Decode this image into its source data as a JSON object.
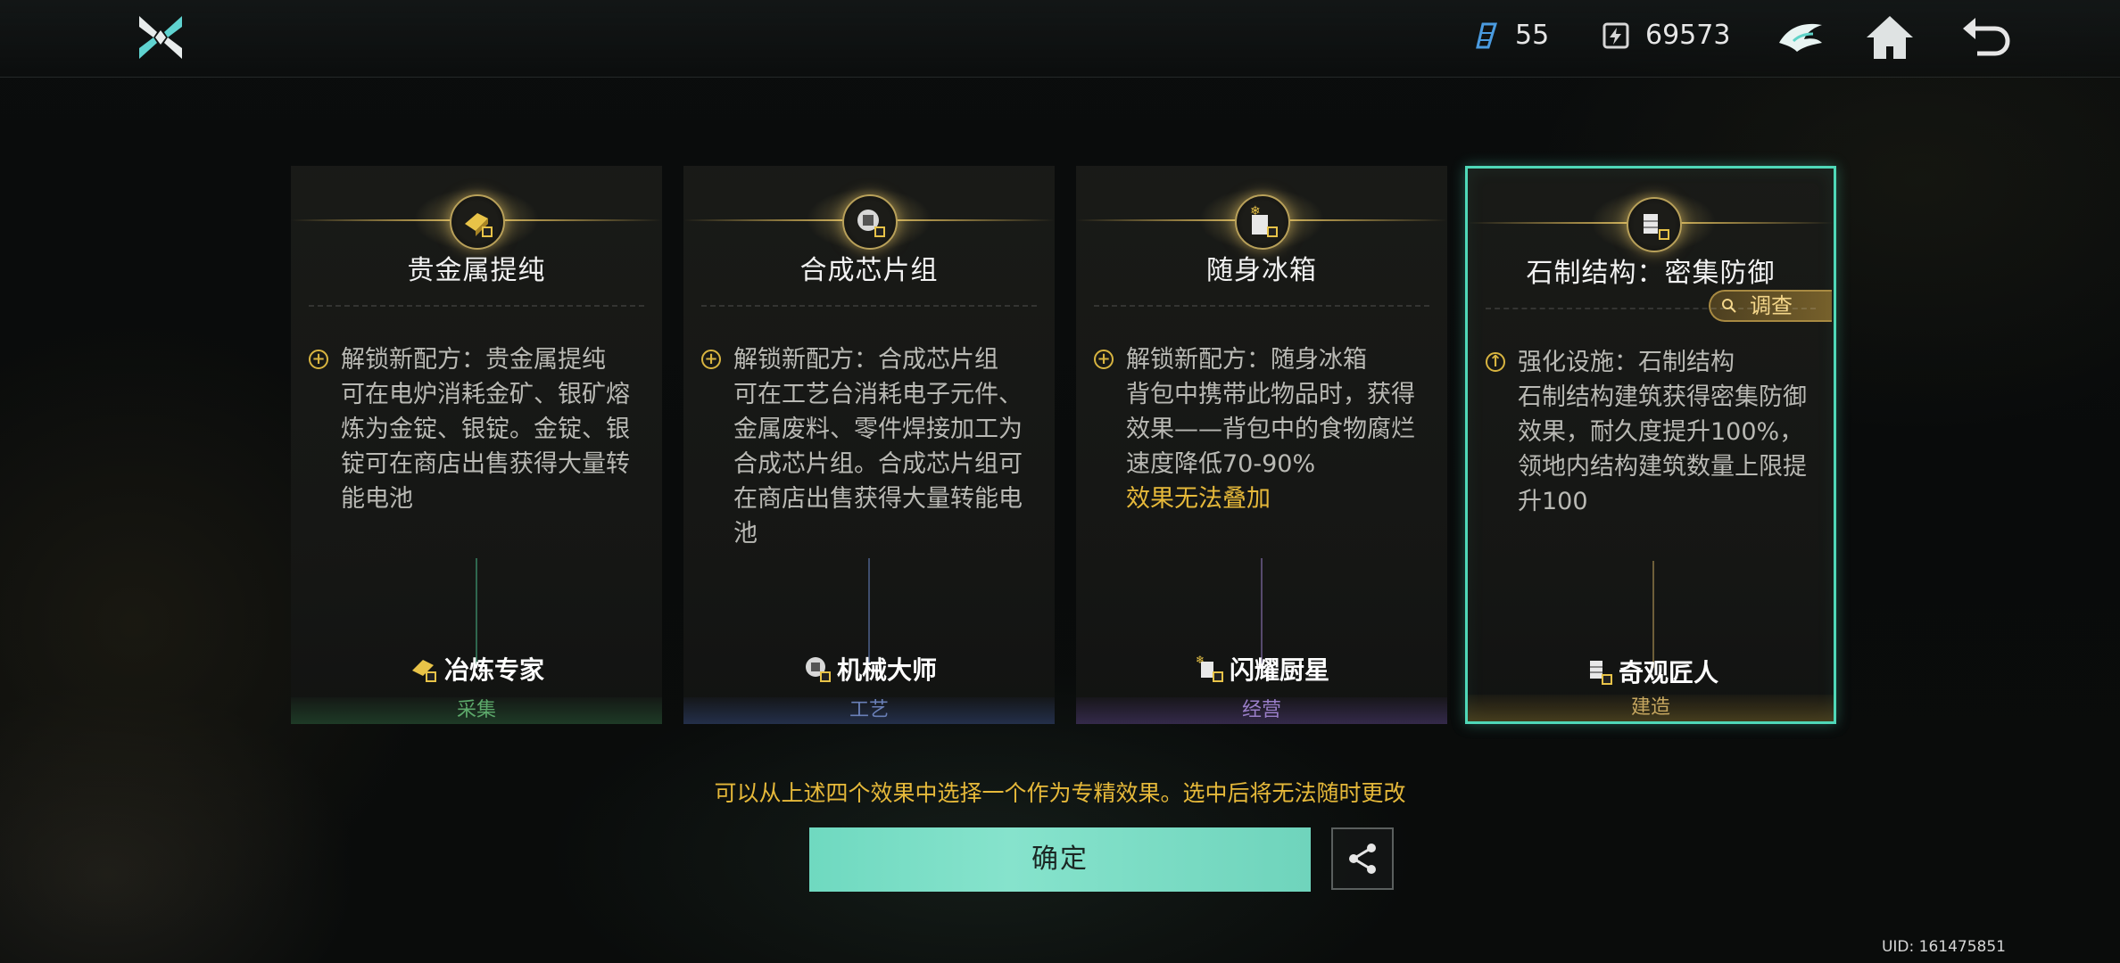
{
  "topbar": {
    "resource1_value": "55",
    "resource2_value": "69573"
  },
  "cards": [
    {
      "title": "贵金属提纯",
      "lead": "解锁新配方：贵金属提纯",
      "body": "可在电炉消耗金矿、银矿熔炼为金锭、银锭。金锭、银锭可在商店出售获得大量转能电池",
      "warn": "",
      "specialist": "冶炼专家",
      "category": "采集",
      "category_color": "green"
    },
    {
      "title": "合成芯片组",
      "lead": "解锁新配方：合成芯片组",
      "body": "可在工艺台消耗电子元件、金属废料、零件焊接加工为合成芯片组。合成芯片组可在商店出售获得大量转能电池",
      "warn": "",
      "specialist": "机械大师",
      "category": "工艺",
      "category_color": "blue"
    },
    {
      "title": "随身冰箱",
      "lead": "解锁新配方：随身冰箱",
      "body": "背包中携带此物品时，获得效果——背包中的食物腐烂速度降低70-90%",
      "warn": "效果无法叠加",
      "specialist": "闪耀厨星",
      "category": "经营",
      "category_color": "purple"
    },
    {
      "title": "石制结构：密集防御",
      "lead": "强化设施：石制结构",
      "body": "石制结构建筑获得密集防御效果，耐久度提升100%，领地内结构建筑数量上限提升100",
      "warn": "",
      "specialist": "奇观匠人",
      "category": "建造",
      "category_color": "gold",
      "tag": "调查",
      "selected": true
    }
  ],
  "hint": "可以从上述四个效果中选择一个作为专精效果。选中后将无法随时更改",
  "confirm_label": "确定",
  "uid": "UID: 161475851",
  "colors": {
    "accent": "#6fd9c0",
    "gold": "#e6b93a",
    "selected_border": "#4fd8b8"
  }
}
